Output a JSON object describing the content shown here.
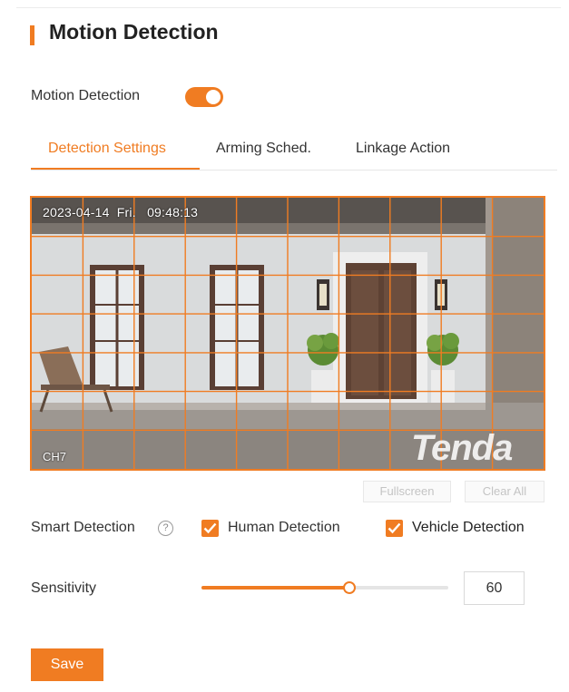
{
  "header": {
    "title": "Motion Detection"
  },
  "motion_detection": {
    "label": "Motion Detection",
    "enabled": true
  },
  "tabs": [
    {
      "label": "Detection Settings",
      "active": true
    },
    {
      "label": "Arming Sched.",
      "active": false
    },
    {
      "label": "Linkage Action",
      "active": false
    }
  ],
  "preview": {
    "timestamp": "2023-04-14  Fri.   09:48:13",
    "channel": "CH7",
    "logo_text": "Tenda",
    "grid_color": "#f07c22"
  },
  "preview_actions": {
    "fullscreen": "Fullscreen",
    "clear_all": "Clear All"
  },
  "smart_detection": {
    "label": "Smart Detection",
    "help_icon": "question-circle-icon",
    "options": [
      {
        "label": "Human Detection",
        "checked": true
      },
      {
        "label": "Vehicle Detection",
        "checked": true
      }
    ]
  },
  "sensitivity": {
    "label": "Sensitivity",
    "value": "60",
    "percent": 60
  },
  "actions": {
    "save": "Save"
  },
  "colors": {
    "accent": "#f07c22"
  }
}
